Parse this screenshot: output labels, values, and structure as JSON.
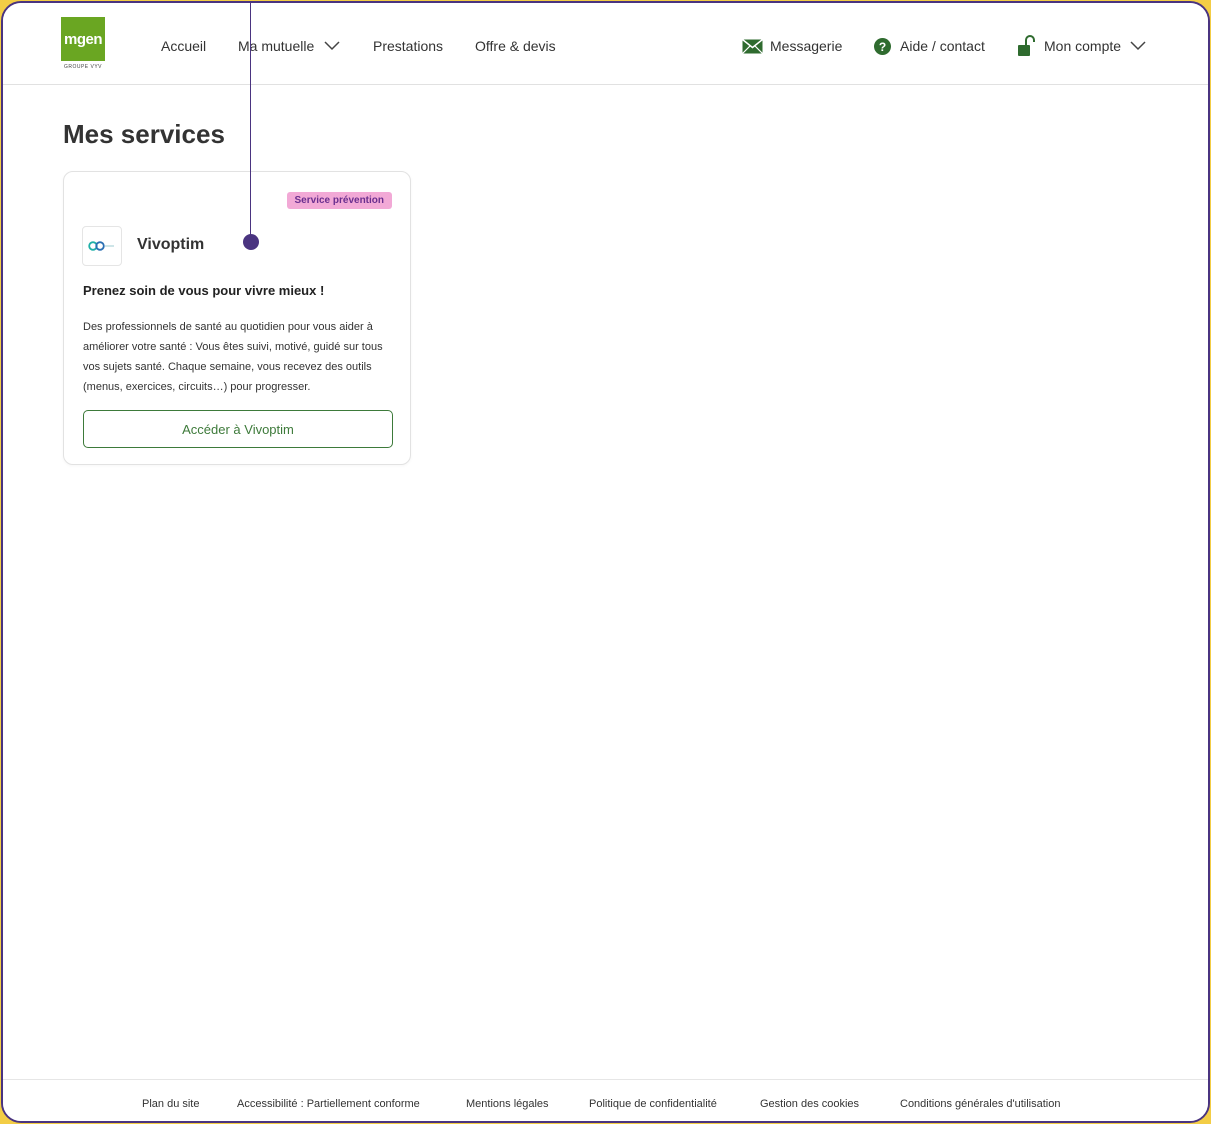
{
  "header": {
    "logo_text": "mgen",
    "logo_subtext": "GROUPE VYV",
    "nav": {
      "accueil": "Accueil",
      "ma_mutuelle": "Ma mutuelle",
      "prestations": "Prestations",
      "offre_devis": "Offre & devis"
    },
    "utility": {
      "messagerie": "Messagerie",
      "aide_contact": "Aide / contact",
      "mon_compte": "Mon compte"
    },
    "icons": {
      "messagerie": "envelope-icon",
      "aide": "help-circle-icon",
      "compte": "unlock-icon",
      "dropdown": "chevron-down-icon"
    }
  },
  "main": {
    "title": "Mes services",
    "services": [
      {
        "badge": "Service prévention",
        "name": "Vivoptim",
        "logo_icon": "vivoptim-logo",
        "heading": "Prenez soin de vous pour vivre mieux !",
        "description": "Des professionnels de santé au quotidien pour vous aider à améliorer votre santé : Vous êtes suivi, motivé, guidé sur tous vos sujets santé. Chaque semaine, vous recevez des outils (menus, exercices, circuits…) pour progresser.",
        "button_label": "Accéder à Vivoptim"
      }
    ]
  },
  "footer": {
    "links": [
      "Plan du site",
      "Accessibilité : Partiellement conforme",
      "Mentions légales",
      "Politique de confidentialité",
      "Gestion des cookies",
      "Conditions générales d'utilisation"
    ]
  },
  "colors": {
    "brand_green": "#6aa622",
    "button_green": "#3d7a3a",
    "badge_bg": "#f2a9d6",
    "badge_text": "#6b2f8f",
    "frame": "#4a3480",
    "background": "#f3cd45"
  }
}
